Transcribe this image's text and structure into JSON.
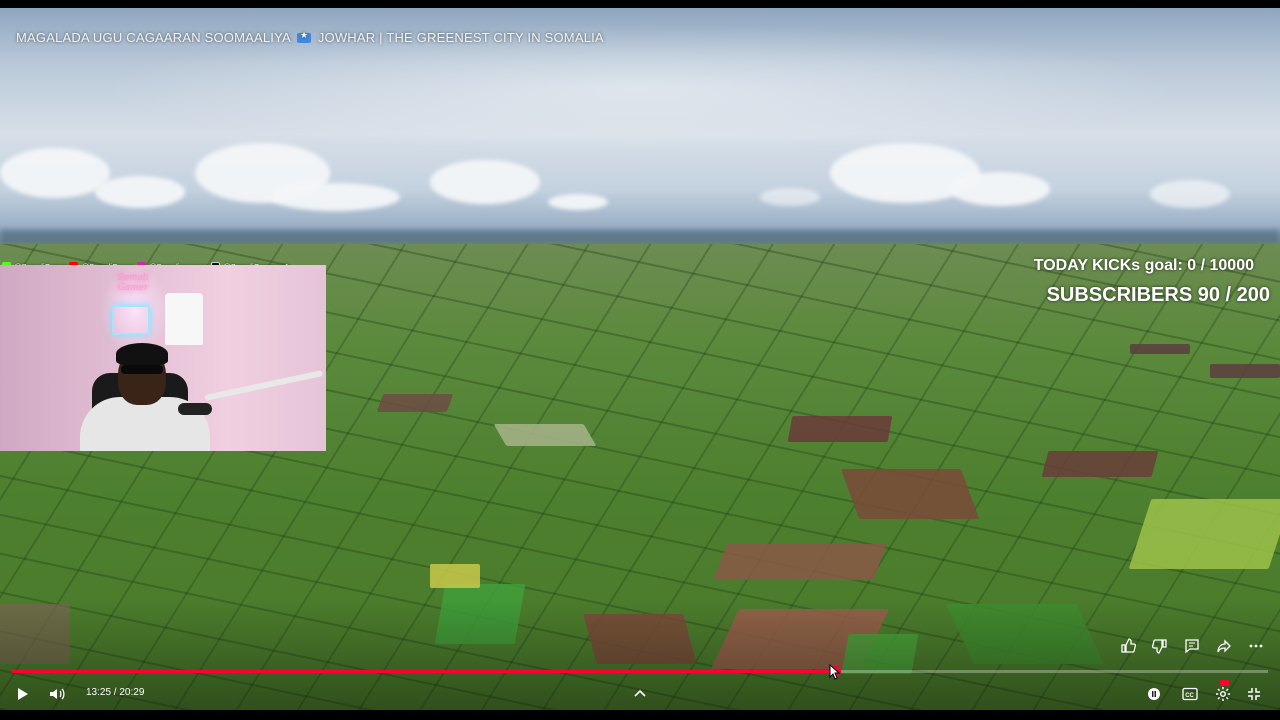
{
  "video": {
    "title": "MAGALADA UGU CAGAARAN SOOMAALIYA",
    "title_flag_icon": "somalia-flag-icon",
    "title_rest": "JOWHAR | THE GREENEST CITY IN SOMALIA"
  },
  "overlay": {
    "socials": [
      {
        "icon": "kick-icon",
        "color": "#53fc18",
        "handle": "@SomaliGamer"
      },
      {
        "icon": "youtube-icon",
        "color": "#ff0000",
        "handle": "@SomaliGamer"
      },
      {
        "icon": "instagram-icon",
        "color": "#d6249f",
        "handle": "@Somaligamergg"
      },
      {
        "icon": "tiktok-icon",
        "color": "#111111",
        "handle": "@SomaliGamergg1"
      }
    ],
    "kicks_goal": "TODAY KICKs goal: 0 / 10000",
    "subscribers": "SUBSCRIBERS 90 / 200",
    "webcam_neon_text": "Somali Gamer"
  },
  "player": {
    "time": "13:25 / 20:29",
    "progress_fraction": 0.655,
    "accent": "#ff0033",
    "actions": [
      "like-icon",
      "dislike-icon",
      "comment-icon",
      "share-icon",
      "more-icon"
    ],
    "controls_left": [
      "play-icon",
      "volume-icon"
    ],
    "controls_right": [
      "autoplay-icon",
      "captions-icon",
      "settings-icon",
      "exit-fullscreen-icon"
    ]
  }
}
